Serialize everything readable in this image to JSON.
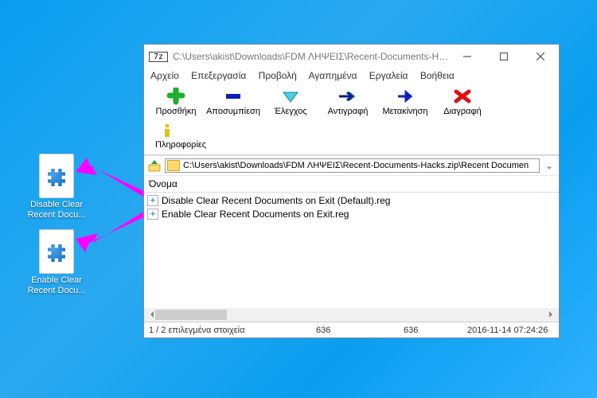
{
  "desktop": {
    "icons": [
      {
        "label": "Disable Clear Recent Docu..."
      },
      {
        "label": "Enable Clear Recent Docu..."
      }
    ]
  },
  "window": {
    "app_icon": "7z",
    "title": "C:\\Users\\akist\\Downloads\\FDM ΛΗΨΕΙΣ\\Recent-Documents-Hacks.zi...",
    "menus": [
      "Αρχείο",
      "Επεξεργασία",
      "Προβολή",
      "Αγαπημένα",
      "Εργαλεία",
      "Βοήθεια"
    ],
    "tools": [
      {
        "label": "Προσθήκη"
      },
      {
        "label": "Αποσυμπίεση"
      },
      {
        "label": "Έλεγχος"
      },
      {
        "label": "Αντιγραφή"
      },
      {
        "label": "Μετακίνηση"
      },
      {
        "label": "Διαγραφή"
      },
      {
        "label": "Πληροφορίες"
      }
    ],
    "path": "C:\\Users\\akist\\Downloads\\FDM ΛΗΨΕΙΣ\\Recent-Documents-Hacks.zip\\Recent Documen",
    "columns": {
      "name": "Όνομα"
    },
    "files": [
      "Disable Clear Recent Documents on Exit (Default).reg",
      "Enable Clear Recent Documents on Exit.reg"
    ],
    "status": {
      "selection": "1 / 2 επιλεγμένα στοιχεία",
      "size1": "636",
      "size2": "636",
      "date": "2016-11-14 07:24:26"
    }
  }
}
